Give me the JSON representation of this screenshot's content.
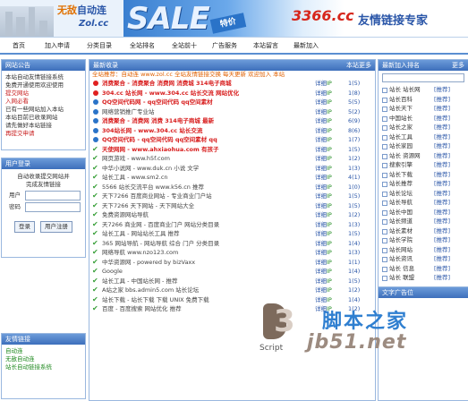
{
  "header": {
    "logo_cn_a": "无敌",
    "logo_cn_b": "自动连",
    "logo_url": "Zol.cc",
    "banner_sale": "SALE",
    "banner_tag": "特价",
    "banner_logo": "3366.cc",
    "banner_text": "友情链接专家"
  },
  "nav": [
    "首页",
    "加入申请",
    "分类目录",
    "全站排名",
    "全站前十",
    "广告服务",
    "本站留言",
    "最新加入"
  ],
  "left": {
    "announce_title": "网站公告",
    "announce_lines": [
      "本站自动友情链接系统",
      "免费开通使用欢迎使用",
      "提交网站",
      "入网必看",
      "已有一些网站加入本站",
      "本站目前已收录网站",
      "请先做好本站链接",
      "再提交申请"
    ],
    "login_title": "用户登录",
    "login_hint_1": "自动收录提交网站并",
    "login_hint_2": "完成友情链接",
    "user_label": "用户",
    "pass_label": "密码",
    "btn_login": "登录",
    "btn_register": "用户注册",
    "friend_title": "友情链接",
    "friend_links": [
      "自动连",
      "无敌自动连",
      "站长自动链接系统"
    ]
  },
  "main": {
    "title": "最新收录",
    "more": "本站更多",
    "ticker": "全站推荐：自动连 www.zol.cc 全站友情链接交换 每天更新 欢迎加入 本站",
    "rows": [
      {
        "icon": "red",
        "style": "red",
        "text": "消费聚合 - 消费聚合 消费网 消费城 314电子商城",
        "d": "详细",
        "c": "IP",
        "n": "1(5)"
      },
      {
        "icon": "red",
        "style": "red",
        "text": "304.cc 站长网 - www.304.cc 站长交流 网站优化",
        "d": "详细",
        "c": "IP",
        "n": "1(8)"
      },
      {
        "icon": "blue",
        "style": "red",
        "text": "QQ空间代码网 - qq空间代码 qq空间素材",
        "d": "详细",
        "c": "IP",
        "n": "5(5)"
      },
      {
        "icon": "blue",
        "style": "gray",
        "text": "网络营销推广专业站",
        "d": "详细",
        "c": "IP",
        "n": "5(2)"
      },
      {
        "icon": "blue",
        "style": "red",
        "text": "消费聚合 - 消费网 消费 314电子商城 最新",
        "d": "详细",
        "c": "IP",
        "n": "6(9)"
      },
      {
        "icon": "blue",
        "style": "red",
        "text": "304站长网 - www.304.cc 站长交流",
        "d": "详细",
        "c": "IP",
        "n": "8(6)"
      },
      {
        "icon": "blue",
        "style": "red",
        "text": "QQ空间代码 - qq空间代码 qq空间素材 qq",
        "d": "详细",
        "c": "IP",
        "n": "1(7)"
      },
      {
        "icon": "check",
        "style": "red",
        "text": "天使网网 - www.ahxiaohua.com 有孩子",
        "d": "详细",
        "c": "IP",
        "n": "1(5)"
      },
      {
        "icon": "check",
        "style": "gray",
        "text": "网页游戏 - www.h5f.com",
        "d": "详细",
        "c": "IP",
        "n": "1(2)"
      },
      {
        "icon": "check",
        "style": "gray",
        "text": "中华小说网 - www.duk.cn 小说 文学",
        "d": "详细",
        "c": "IP",
        "n": "1(3)"
      },
      {
        "icon": "check",
        "style": "gray",
        "text": "站长工具 - www.sm2.cn",
        "d": "详细",
        "c": "IP",
        "n": "4(1)"
      },
      {
        "icon": "check",
        "style": "gray",
        "text": "5566 站长交流平台 www.k56.cn 推荐",
        "d": "详细",
        "c": "IP",
        "n": "1(0)"
      },
      {
        "icon": "check",
        "style": "gray",
        "text": "天下7266 百度商业网站 - 专业商业门户站",
        "d": "详细",
        "c": "IP",
        "n": "1(5)"
      },
      {
        "icon": "check",
        "style": "gray",
        "text": "天下7266 天下网站 - 天下网站大全",
        "d": "详细",
        "c": "IP",
        "n": "1(5)"
      },
      {
        "icon": "check",
        "style": "gray",
        "text": "免费资源网站导航",
        "d": "详细",
        "c": "IP",
        "n": "1(2)"
      },
      {
        "icon": "check",
        "style": "gray",
        "text": "天7266 商业网 - 百度商业门户 网站分类目录",
        "d": "详细",
        "c": "IP",
        "n": "1(3)"
      },
      {
        "icon": "check",
        "style": "gray",
        "text": "站长工具 - 网站站长工具 推荐",
        "d": "详细",
        "c": "IP",
        "n": "1(5)"
      },
      {
        "icon": "check",
        "style": "gray",
        "text": "365 网站导航 - 网站导航 综合 门户 分类目录",
        "d": "详细",
        "c": "IP",
        "n": "1(4)"
      },
      {
        "icon": "check",
        "style": "gray",
        "text": "网络导航 www.nzo123.com",
        "d": "详细",
        "c": "IP",
        "n": "1(3)"
      },
      {
        "icon": "check",
        "style": "gray",
        "text": "中华资源网 - powered by bizVaxx",
        "d": "详细",
        "c": "IP",
        "n": "1(1)"
      },
      {
        "icon": "check",
        "style": "gray",
        "text": "Google",
        "d": "详细",
        "c": "IP",
        "n": "1(4)"
      },
      {
        "icon": "check",
        "style": "gray",
        "text": "站长工具 - 中国站长网 - 推荐",
        "d": "详细",
        "c": "IP",
        "n": "1(5)"
      },
      {
        "icon": "check",
        "style": "gray",
        "text": "A站之家 bbs.admin5.com 站长论坛",
        "d": "详细",
        "c": "IP",
        "n": "1(2)"
      },
      {
        "icon": "check",
        "style": "gray",
        "text": "站长下载 - 站长下载 下载 UNIX 免费下载",
        "d": "详细",
        "c": "IP",
        "n": "1(4)"
      },
      {
        "icon": "check",
        "style": "gray",
        "text": "百度 - 百度搜索 网站优化 推荐",
        "d": "详细",
        "c": "IP",
        "n": "1(2)"
      }
    ]
  },
  "right": {
    "rank_title": "最新加入排名",
    "rank_more": "更多",
    "search_placeholder": "",
    "rank_rows": [
      {
        "name": "站长 站长网",
        "tag": "[推荐]"
      },
      {
        "name": "站长百科",
        "tag": "[推荐]"
      },
      {
        "name": "站长天下",
        "tag": "[推荐]"
      },
      {
        "name": "中国站长",
        "tag": "[推荐]"
      },
      {
        "name": "站长之家",
        "tag": "[推荐]"
      },
      {
        "name": "站长工具",
        "tag": "[推荐]"
      },
      {
        "name": "站长家园",
        "tag": "[推荐]"
      },
      {
        "name": "站长 资源网",
        "tag": "[推荐]"
      },
      {
        "name": "搜索引擎",
        "tag": "[推荐]"
      },
      {
        "name": "站长下载",
        "tag": "[推荐]"
      },
      {
        "name": "站长推荐",
        "tag": "[推荐]"
      },
      {
        "name": "站长论坛",
        "tag": "[推荐]"
      },
      {
        "name": "站长导航",
        "tag": "[推荐]"
      },
      {
        "name": "站长中国",
        "tag": "[推荐]"
      },
      {
        "name": "站长频道",
        "tag": "[推荐]"
      },
      {
        "name": "站长素材",
        "tag": "[推荐]"
      },
      {
        "name": "站长学院",
        "tag": "[推荐]"
      },
      {
        "name": "站长网站",
        "tag": "[推荐]"
      },
      {
        "name": "站长资讯",
        "tag": "[推荐]"
      },
      {
        "name": "站长 信息",
        "tag": "[推荐]"
      },
      {
        "name": "站长 联盟",
        "tag": "[推荐]"
      }
    ],
    "p2_title": "文字广告位"
  },
  "watermark": {
    "script_text": "Script",
    "cn_text": "脚本之家",
    "url_text": "jb51.net"
  }
}
